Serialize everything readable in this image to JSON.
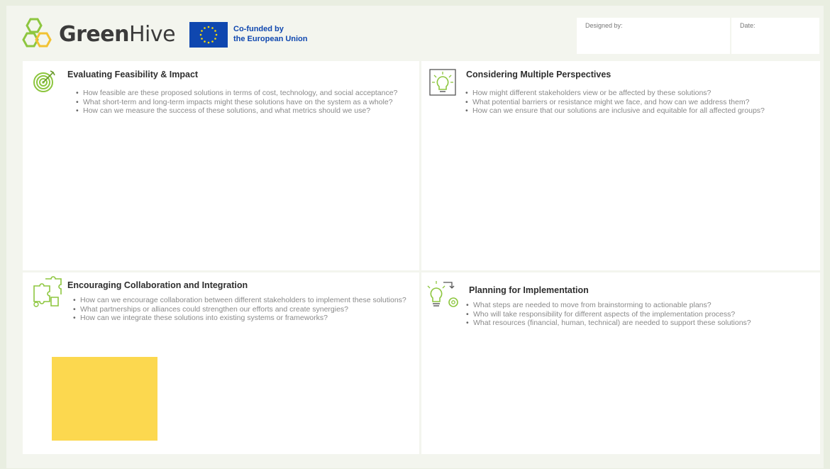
{
  "header": {
    "brand_bold": "Green",
    "brand_light": "Hive",
    "eu_line1": "Co-funded by",
    "eu_line2": "the European Union",
    "designed_by_label": "Designed by:",
    "date_label": "Date:"
  },
  "colors": {
    "accent_green": "#8dc63f",
    "eu_blue": "#0f47af",
    "sticky_yellow": "#fcd84f"
  },
  "sections": [
    {
      "title": "Evaluating Feasibility & Impact",
      "icon": "target-icon",
      "items": [
        "How feasible are these proposed solutions in terms of cost, technology, and social acceptance?",
        "What short-term and long-term impacts might these solutions have on the system as a whole?",
        "How can we measure the success of these solutions, and what metrics should we use?"
      ]
    },
    {
      "title": "Considering Multiple Perspectives",
      "icon": "lightbulb-idea-icon",
      "items": [
        "How might different stakeholders view or be affected by these solutions?",
        "What potential barriers or resistance might we face, and how can we address them?",
        "How can we ensure that our solutions are inclusive and equitable for all affected groups?"
      ]
    },
    {
      "title": "Encouraging Collaboration and Integration",
      "icon": "puzzle-collaboration-icon",
      "items": [
        "How can we encourage collaboration between different stakeholders to implement these solutions?",
        "What partnerships or alliances could strengthen our efforts and create synergies?",
        "How can we integrate these solutions into existing systems or frameworks?"
      ]
    },
    {
      "title": "Planning for Implementation",
      "icon": "idea-gear-icon",
      "items": [
        "What steps are needed to move from brainstorming to actionable plans?",
        "Who will take responsibility for different aspects of the implementation process?",
        "What resources (financial, human, technical) are needed to support these solutions?"
      ]
    }
  ]
}
